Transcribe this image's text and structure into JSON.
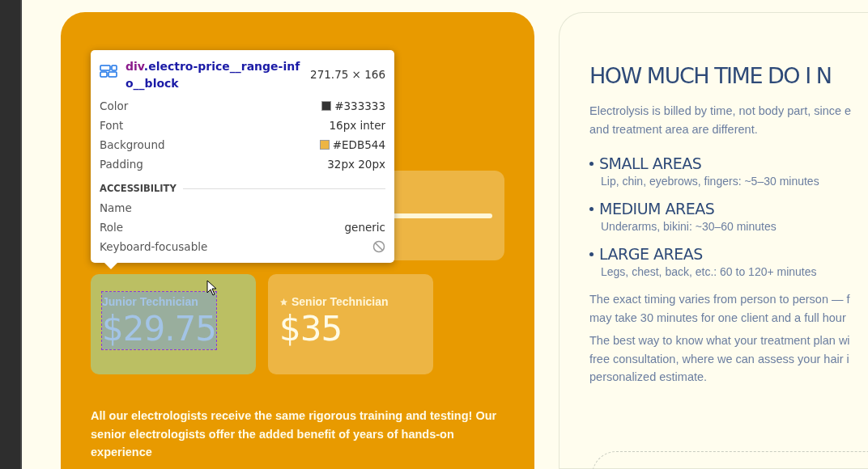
{
  "pricing": {
    "tiers": [
      {
        "kind": "junior",
        "label": "Junior Technician",
        "price": "$29.75",
        "highlighted": true
      },
      {
        "kind": "senior",
        "label": "Senior Technician",
        "price": "$35",
        "highlighted": false
      }
    ],
    "note": "All our electrologists receive the same rigorous training and testing! Our senior electrologists offer the added benefit of years of hands-on experience"
  },
  "inspector": {
    "tag": "div",
    "class_name": ".electro-price__range-inf",
    "class_name_2": "o__block",
    "size": "271.75 × 166",
    "rows": [
      {
        "kind": "color",
        "label": "Color",
        "value": "#333333",
        "color": "#333333"
      },
      {
        "kind": "text",
        "label": "Font",
        "value": "16px inter"
      },
      {
        "kind": "color",
        "label": "Background",
        "value": "#EDB544",
        "color": "#edb544"
      },
      {
        "kind": "text",
        "label": "Padding",
        "value": "32px 20px"
      }
    ],
    "section": "ACCESSIBILITY",
    "a11y_rows": [
      {
        "kind": "empty",
        "label": "Name"
      },
      {
        "kind": "text",
        "label": "Role",
        "value": "generic"
      },
      {
        "kind": "blocked",
        "label": "Keyboard-focusable"
      }
    ]
  },
  "info": {
    "heading": "HOW MUCH TIME DO I N",
    "intro": [
      "Electrolysis is billed by time, not body part, since e",
      "and treatment area are different."
    ],
    "areas": [
      {
        "title": "SMALL AREAS",
        "detail": "Lip, chin, eyebrows, fingers: ~5–30 minutes"
      },
      {
        "title": "MEDIUM AREAS",
        "detail": "Underarms, bikini: ~30–60 minutes"
      },
      {
        "title": "LARGE AREAS",
        "detail": "Legs, chest, back, etc.: 60 to 120+ minutes"
      }
    ],
    "paragraphs": [
      [
        "The exact timing varies from person to person — f",
        "may take 30 minutes for one client and a full hour"
      ],
      [
        "The best way to know what your treatment plan wi",
        "free consultation, where we can assess your hair i",
        "personalized estimate."
      ]
    ]
  }
}
